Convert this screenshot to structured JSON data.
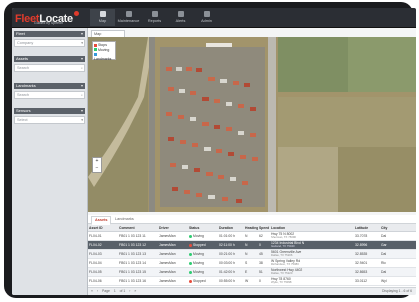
{
  "app": {
    "logo_part1": "Fleet",
    "logo_part2": "Locate",
    "tagline": "Guided by Spireon"
  },
  "nav": [
    {
      "label": "Map",
      "icon": "map-icon"
    },
    {
      "label": "Maintenance",
      "icon": "wrench-icon"
    },
    {
      "label": "Reports",
      "icon": "report-icon"
    },
    {
      "label": "Alerts",
      "icon": "bell-icon"
    },
    {
      "label": "Admin",
      "icon": "gear-icon"
    }
  ],
  "sidebar": {
    "panels": [
      {
        "title": "Fleet",
        "field": "Company"
      },
      {
        "title": "Assets",
        "field": "Search"
      },
      {
        "title": "Landmarks",
        "field": "Search"
      },
      {
        "title": "Sensors",
        "field": "Select"
      }
    ]
  },
  "map": {
    "tab_label": "Map",
    "legend": [
      {
        "label": "Stops",
        "color": "#e74c3c"
      },
      {
        "label": "Moving",
        "color": "#2ecc71"
      },
      {
        "label": "Landmarks",
        "color": "#3498db"
      }
    ],
    "zoom_in": "+",
    "zoom_out": "−"
  },
  "grid": {
    "tabs": [
      "Assets",
      "Landmarks"
    ],
    "columns": [
      "Asset ID",
      "Comment",
      "Driver",
      "Status",
      "Duration",
      "Heading",
      "Speed",
      "Location",
      "Latitude",
      "City"
    ],
    "rows": [
      {
        "id": "FL04-01",
        "comment": "FB01 1 03 123 11",
        "driver": "JamesMan",
        "status": "Moving",
        "status_color": "#2ecc71",
        "duration": "01:01:00 h",
        "heading": "N",
        "speed": "62",
        "loc1": "Hwy 75 N 8002",
        "loc2": "Sherman, TX 75090",
        "lat": "33.7078",
        "city": "Dal"
      },
      {
        "id": "FL04-02",
        "comment": "FB01 1 03 123 12",
        "driver": "JamesMan",
        "status": "Stopped",
        "status_color": "#e74c3c",
        "duration": "02:11:00 h",
        "heading": "N",
        "speed": "0",
        "loc1": "1234 Industrial Blvd N",
        "loc2": "Garland, TX 75040",
        "lat": "32.8996",
        "city": "Gar"
      },
      {
        "id": "FL04-03",
        "comment": "FB01 1 03 123 13",
        "driver": "JamesMan",
        "status": "Moving",
        "status_color": "#2ecc71",
        "duration": "00:21:00 h",
        "heading": "N",
        "speed": "45",
        "loc1": "5601 Greenville Ave",
        "loc2": "Dallas, TX 75206",
        "lat": "32.8535",
        "city": "Dal"
      },
      {
        "id": "FL04-04",
        "comment": "FB01 1 03 123 14",
        "driver": "JamesMan",
        "status": "Moving",
        "status_color": "#2ecc71",
        "duration": "00:03:00 h",
        "heading": "S",
        "speed": "38",
        "loc1": "W Spring Valley Rd",
        "loc2": "Richardson, TX 75080",
        "lat": "32.9401",
        "city": "Ric"
      },
      {
        "id": "FL04-05",
        "comment": "FB01 1 03 123 15",
        "driver": "JamesMan",
        "status": "Moving",
        "status_color": "#2ecc71",
        "duration": "01:42:00 h",
        "heading": "E",
        "speed": "51",
        "loc1": "Northwest Hwy 4402",
        "loc2": "Dallas, TX 75220",
        "lat": "32.8653",
        "city": "Dal"
      },
      {
        "id": "FL04-06",
        "comment": "FB01 1 03 123 16",
        "driver": "JamesMan",
        "status": "Stopped",
        "status_color": "#e74c3c",
        "duration": "00:55:00 h",
        "heading": "W",
        "speed": "0",
        "loc1": "Hwy 78 8760",
        "loc2": "Wylie, TX 75098",
        "lat": "33.0112",
        "city": "Wyl"
      }
    ],
    "pager": {
      "page": "Page",
      "num": "1",
      "of": "of 1",
      "summary": "Displaying 1 - 6 of 6"
    }
  }
}
